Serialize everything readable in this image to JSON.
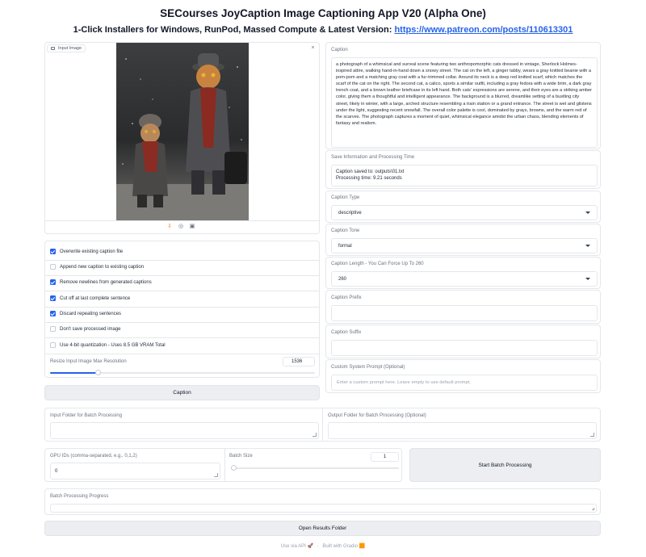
{
  "app": {
    "title": "SECourses JoyCaption Image Captioning App V20 (Alpha One)",
    "subtitle_prefix": "1-Click Installers for Windows, RunPod, Massed Compute & Latest Version: ",
    "subtitle_link": "https://www.patreon.com/posts/110613301"
  },
  "input_image": {
    "label": "Input Image",
    "close_icon": "close-icon",
    "toolbar_icons": [
      "download-icon",
      "share-icon",
      "clipboard-icon"
    ]
  },
  "options": {
    "checkboxes": [
      {
        "label": "Overwrite existing caption file",
        "checked": true
      },
      {
        "label": "Append new caption to existing caption",
        "checked": false
      },
      {
        "label": "Remove newlines from generated captions",
        "checked": true
      },
      {
        "label": "Cut off at last complete sentence",
        "checked": true
      },
      {
        "label": "Discard repeating sentences",
        "checked": true
      },
      {
        "label": "Don't save processed image",
        "checked": false
      },
      {
        "label": "Use 4-bit quantization - Uses 8.5 GB VRAM Total",
        "checked": false
      }
    ],
    "resize_label": "Resize Input Image Max Resolution",
    "resize_value": "1536",
    "resize_fraction": 0.18
  },
  "caption_button": "Caption",
  "caption": {
    "label": "Caption",
    "text": "a photograph of a whimsical and surreal scene featuring two anthropomorphic cats dressed in vintage, Sherlock Holmes-inspired attire, walking hand-in-hand down a snowy street. The cat on the left, a ginger tabby, wears a gray knitted beanie with a pom-pom and a matching gray coat with a fur-trimmed collar. Around its neck is a deep red knitted scarf, which matches the scarf of the cat on the right. The second cat, a calico, sports a similar outfit, including a gray fedora with a wide brim, a dark gray trench coat, and a brown leather briefcase in its left hand. Both cats' expressions are serene, and their eyes are a striking amber color, giving them a thoughtful and intelligent appearance. The background is a blurred, dreamlike setting of a bustling city street, likely in winter, with a large, arched structure resembling a train station or a grand entrance. The street is wet and glistens under the light, suggesting recent snowfall. The overall color palette is cool, dominated by grays, browns, and the warm red of the scarves. The photograph captures a moment of quiet, whimsical elegance amidst the urban chaos, blending elements of fantasy and realism."
  },
  "save_info": {
    "label": "Save Information and Processing Time",
    "line1": "Caption saved to: outputs\\01.txt",
    "line2": "Processing time: 9.21 seconds"
  },
  "caption_type": {
    "label": "Caption Type",
    "value": "descriptive"
  },
  "caption_tone": {
    "label": "Caption Tone",
    "value": "formal"
  },
  "caption_length": {
    "label": "Caption Length - You Can Force Up To 260",
    "value": "260"
  },
  "caption_prefix": {
    "label": "Caption Prefix",
    "value": ""
  },
  "caption_suffix": {
    "label": "Caption Suffix",
    "value": ""
  },
  "system_prompt": {
    "label": "Custom System Prompt (Optional)",
    "placeholder": "Enter a custom prompt here. Leave empty to use default prompt."
  },
  "batch": {
    "input_folder_label": "Input Folder for Batch Processing",
    "output_folder_label": "Output Folder for Batch Processing (Optional)",
    "gpu_label": "GPU IDs (comma-separated, e.g., 0,1,2)",
    "gpu_value": "0",
    "batch_size_label": "Batch Size",
    "batch_size_value": "1",
    "batch_size_fraction": 0.0,
    "start_button": "Start Batch Processing",
    "progress_label": "Batch Processing Progress",
    "open_folder_button": "Open Results Folder"
  },
  "footer": {
    "api": "Use via API",
    "separator": "·",
    "built": "Built with Gradio"
  },
  "colors": {
    "accent": "#2563eb",
    "button_bg": "#eceef1"
  }
}
